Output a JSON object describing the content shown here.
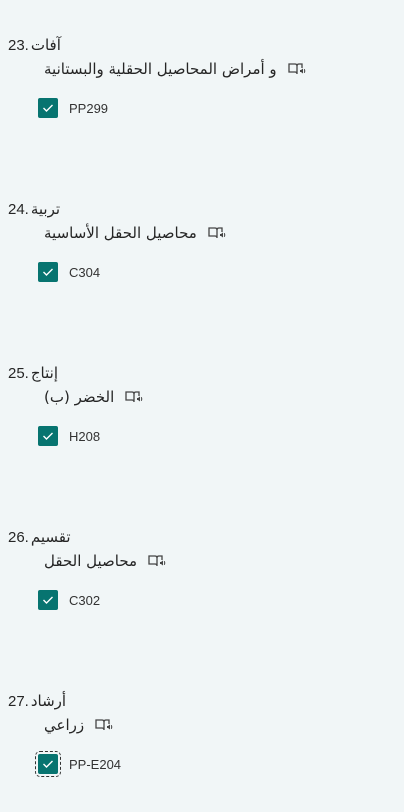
{
  "questions": [
    {
      "number": "23.",
      "title": "آفات",
      "subtitle": "و أمراض المحاصيل الحقلية  والبستانية",
      "option": "PP299"
    },
    {
      "number": "24.",
      "title": "تربية",
      "subtitle": "محاصيل الحقل الأساسية",
      "option": "C304"
    },
    {
      "number": "25.",
      "title": "إنتاج",
      "subtitle": "الخضر (ب)",
      "option": "H208"
    },
    {
      "number": "26.",
      "title": "تقسيم",
      "subtitle": "محاصيل الحقل",
      "option": "C302"
    },
    {
      "number": "27.",
      "title": "أرشاد",
      "subtitle": "زراعي",
      "option": "PP-E204"
    }
  ],
  "colors": {
    "checkbox": "#077470",
    "background": "#f1f6f7"
  },
  "icons": {
    "reader": "immersive-reader-icon",
    "check": "check-icon"
  }
}
